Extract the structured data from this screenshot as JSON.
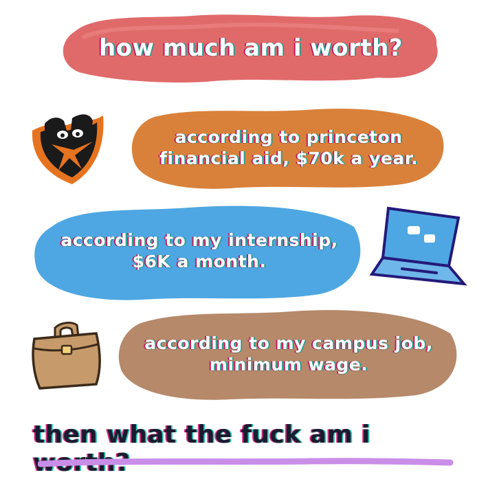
{
  "bubbles": {
    "question": "how much am i worth?",
    "princeton_line1": "according to princeton",
    "princeton_line2": "financial aid, $70k a year.",
    "internship_line1": "according to my internship,",
    "internship_line2": "$6K a month.",
    "campus_line1": "according to my campus job,",
    "campus_line2": "minimum wage."
  },
  "closing": {
    "text": "then what the fuck am i worth?"
  },
  "icons": {
    "shield": "tiger-shield-icon",
    "laptop": "laptop-icon",
    "briefcase": "briefcase-icon"
  },
  "colors": {
    "bubble_red": "#e06a6a",
    "bubble_orange": "#d9813a",
    "bubble_blue": "#4ea7e2",
    "bubble_brown": "#b5896a",
    "underline_purple": "#c98ee8"
  }
}
